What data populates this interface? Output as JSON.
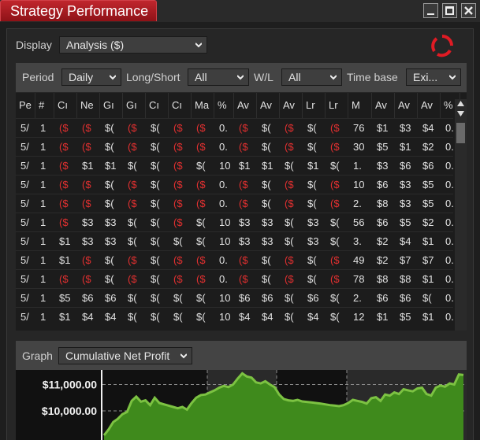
{
  "window": {
    "title": "Strategy Performance",
    "controls": [
      "_",
      "□",
      "X"
    ]
  },
  "display": {
    "label": "Display",
    "value": "Analysis ($)"
  },
  "filters": {
    "period": {
      "label": "Period",
      "value": "Daily"
    },
    "long_short": {
      "label": "Long/Short",
      "value": "All"
    },
    "wl": {
      "label": "W/L",
      "value": "All"
    },
    "time_base": {
      "label": "Time base",
      "value": "Exi..."
    }
  },
  "table": {
    "columns": [
      "Pe",
      "#",
      "Cı",
      "Ne",
      "Gı",
      "Gı",
      "Cı",
      "Cı",
      "Ma",
      "%",
      "Av",
      "Av",
      "Av",
      "Lr",
      "Lr",
      "M",
      "Av",
      "Av",
      "Av",
      "%"
    ],
    "rows": [
      [
        "5/",
        "1",
        "($",
        "($",
        "$(",
        "($",
        "$(",
        "($",
        "($",
        "0.",
        "($",
        "$(",
        "($",
        "$(",
        "($",
        "76",
        "$1",
        "$3",
        "$4",
        "0."
      ],
      [
        "5/",
        "1",
        "($",
        "($",
        "$(",
        "($",
        "$(",
        "($",
        "($",
        "0.",
        "($",
        "$(",
        "($",
        "$(",
        "($",
        "30",
        "$5",
        "$1",
        "$2",
        "0."
      ],
      [
        "5/",
        "1",
        "($",
        "$1",
        "$1",
        "$(",
        "$(",
        "($",
        "$(",
        "10",
        "$1",
        "$1",
        "$(",
        "$1",
        "$(",
        "1.",
        "$3",
        "$6",
        "$6",
        "0."
      ],
      [
        "5/",
        "1",
        "($",
        "($",
        "$(",
        "($",
        "$(",
        "($",
        "($",
        "0.",
        "($",
        "$(",
        "($",
        "$(",
        "($",
        "10",
        "$6",
        "$3",
        "$5",
        "0."
      ],
      [
        "5/",
        "1",
        "($",
        "($",
        "$(",
        "($",
        "$(",
        "($",
        "($",
        "0.",
        "($",
        "$(",
        "($",
        "$(",
        "($",
        "2.",
        "$8",
        "$3",
        "$5",
        "0."
      ],
      [
        "5/",
        "1",
        "($",
        "$3",
        "$3",
        "$(",
        "$(",
        "($",
        "$(",
        "10",
        "$3",
        "$3",
        "$(",
        "$3",
        "$(",
        "56",
        "$6",
        "$5",
        "$2",
        "0."
      ],
      [
        "5/",
        "1",
        "$1",
        "$3",
        "$3",
        "$(",
        "$(",
        "$(",
        "$(",
        "10",
        "$3",
        "$3",
        "$(",
        "$3",
        "$(",
        "3.",
        "$2",
        "$4",
        "$1",
        "0."
      ],
      [
        "5/",
        "1",
        "$1",
        "($",
        "$(",
        "($",
        "$(",
        "($",
        "($",
        "0.",
        "($",
        "$(",
        "($",
        "$(",
        "($",
        "49",
        "$2",
        "$7",
        "$7",
        "0."
      ],
      [
        "5/",
        "1",
        "($",
        "($",
        "$(",
        "($",
        "$(",
        "($",
        "($",
        "0.",
        "($",
        "$(",
        "($",
        "$(",
        "($",
        "78",
        "$8",
        "$8",
        "$1",
        "0."
      ],
      [
        "5/",
        "1",
        "$5",
        "$6",
        "$6",
        "$(",
        "$(",
        "$(",
        "$(",
        "10",
        "$6",
        "$6",
        "$(",
        "$6",
        "$(",
        "2.",
        "$6",
        "$6",
        "$(",
        "0."
      ],
      [
        "5/",
        "1",
        "$1",
        "$4",
        "$4",
        "$(",
        "$(",
        "$(",
        "$(",
        "10",
        "$4",
        "$4",
        "$(",
        "$4",
        "$(",
        "12",
        "$1",
        "$5",
        "$1",
        "0."
      ]
    ]
  },
  "graph": {
    "label": "Graph",
    "value": "Cumulative Net Profit"
  },
  "chart_data": {
    "type": "area",
    "title": "",
    "ylabel": "",
    "y_tick_labels": [
      "$11,000.00",
      "$10,000.00"
    ],
    "ylim": [
      8900,
      11550
    ],
    "x": [
      0,
      1,
      2,
      3,
      4,
      5,
      6,
      7,
      8,
      9,
      10,
      11,
      12,
      13,
      14,
      15,
      16,
      17,
      18,
      19,
      20,
      21,
      22,
      23,
      24,
      25,
      26,
      27,
      28,
      29,
      30,
      31,
      32,
      33,
      34,
      35,
      36,
      37,
      38,
      39,
      40,
      41,
      42,
      43,
      44,
      45,
      46,
      47,
      48,
      49,
      50,
      51,
      52,
      53,
      54,
      55,
      56,
      57,
      58,
      59,
      60,
      61,
      62,
      63,
      64,
      65,
      66,
      67,
      68,
      69,
      70,
      71,
      72,
      73,
      74,
      75,
      76,
      77,
      78
    ],
    "values": [
      9080,
      9300,
      9580,
      9700,
      9880,
      9960,
      10380,
      10540,
      10350,
      10400,
      10220,
      10500,
      10300,
      10250,
      10200,
      10150,
      10100,
      10150,
      10050,
      10300,
      10500,
      10600,
      10620,
      10700,
      10780,
      10880,
      10950,
      10900,
      11000,
      11220,
      11420,
      11300,
      11260,
      11080,
      11040,
      11120,
      11000,
      10900,
      10620,
      10450,
      10400,
      10380,
      10420,
      10360,
      10340,
      10320,
      10300,
      10280,
      10250,
      10220,
      10200,
      10180,
      10220,
      10300,
      10420,
      10380,
      10340,
      10280,
      10480,
      10520,
      10380,
      10620,
      10580,
      10700,
      10640,
      10820,
      10780,
      10740,
      10850,
      10880,
      10640,
      10580,
      10880,
      10960,
      10920,
      11040,
      11000,
      11380,
      11360
    ],
    "series_color": "#7cc242",
    "fill_color": "#3f8a1c",
    "grid": true
  }
}
